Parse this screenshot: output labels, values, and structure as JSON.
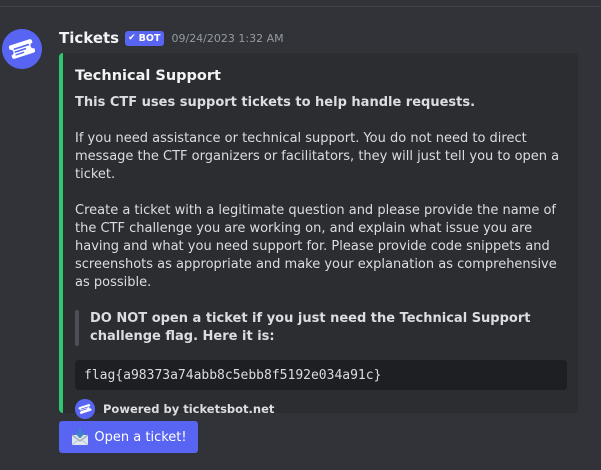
{
  "message": {
    "author": "Tickets",
    "bot_badge": "BOT",
    "bot_badge_icon": "checkmark-icon",
    "timestamp": "09/24/2023 1:32 AM",
    "avatar_icon": "ticket-icon"
  },
  "embed": {
    "accent_color": "#2dc770",
    "title": "Technical Support",
    "intro_bold": "This CTF uses support tickets to help handle requests.",
    "paragraph_1": "If you need assistance or technical support. You do not need to direct message the CTF organizers or facilitators, they will just tell you to open a ticket.",
    "paragraph_2": "Create a ticket with a legitimate question and please provide the name of the CTF challenge you are working on, and explain what issue you are having and what you need support for. Please provide code snippets and screenshots as appropriate and make your explanation as comprehensive as possible.",
    "quote": "DO NOT open a ticket if you just need the Technical Support challenge flag. Here it is:",
    "code": "flag{a98373a74abb8c5ebb8f5192e034a91c}",
    "footer_text": "Powered by ticketsbot.net",
    "footer_icon": "ticket-icon"
  },
  "button": {
    "label": "Open a ticket!",
    "emoji": "envelope-with-arrow-icon",
    "color": "#5865f2"
  },
  "colors": {
    "background": "#313338",
    "embed_background": "#2b2d31",
    "code_background": "#1e1f22"
  }
}
